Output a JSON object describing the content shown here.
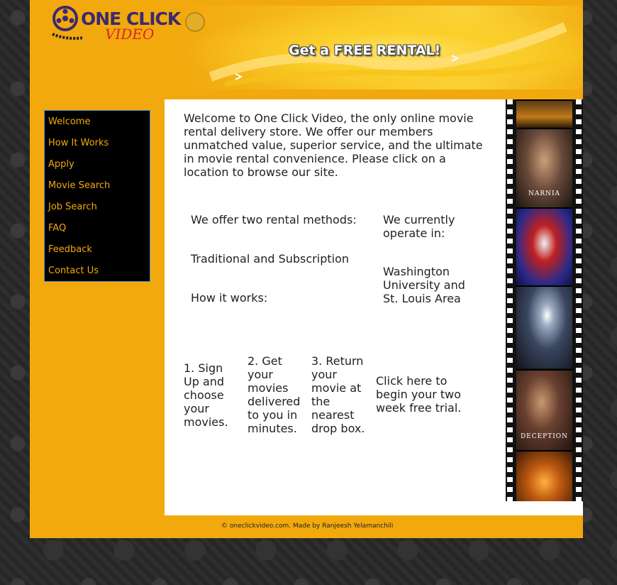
{
  "header": {
    "logo_line1": "ONE CLICK",
    "logo_line2": "VIDEO",
    "banner_text": "Get a FREE RENTAL!"
  },
  "nav": {
    "items": [
      {
        "label": "Welcome"
      },
      {
        "label": "How It Works"
      },
      {
        "label": "Apply"
      },
      {
        "label": "Movie Search"
      },
      {
        "label": "Job Search"
      },
      {
        "label": "FAQ"
      },
      {
        "label": "Feedback"
      },
      {
        "label": "Contact Us"
      }
    ]
  },
  "main": {
    "intro": "Welcome to One Click Video, the only online movie rental delivery store. We offer our members unmatched value, superior service, and the ultimate in movie rental convenience. Please click on a location to browse our site.",
    "rental_methods_heading": "We offer two rental methods:",
    "rental_methods": "Traditional and Subscription",
    "how_it_works_heading": "How it works:",
    "operate_heading": "We currently operate in:",
    "operate_location": "Washington University and St. Louis Area",
    "steps": [
      {
        "text": "1. Sign Up and choose your movies."
      },
      {
        "text": "2. Get your movies delivered to you in minutes."
      },
      {
        "text": "3. Return your movie at the nearest drop box."
      }
    ],
    "trial_link": "Click here to begin your two week free trial."
  },
  "filmstrip": {
    "frame_labels": [
      "NARNIA",
      "DECEPTION"
    ]
  },
  "footer": {
    "text": "© oneclickvideo.com. Made by Ranjeesh Yelamanchili"
  },
  "colors": {
    "accent": "#f2a90e",
    "nav_bg": "#000000",
    "nav_text": "#f2a90e",
    "logo_purple": "#3b2a6e",
    "logo_red": "#d8262a"
  }
}
